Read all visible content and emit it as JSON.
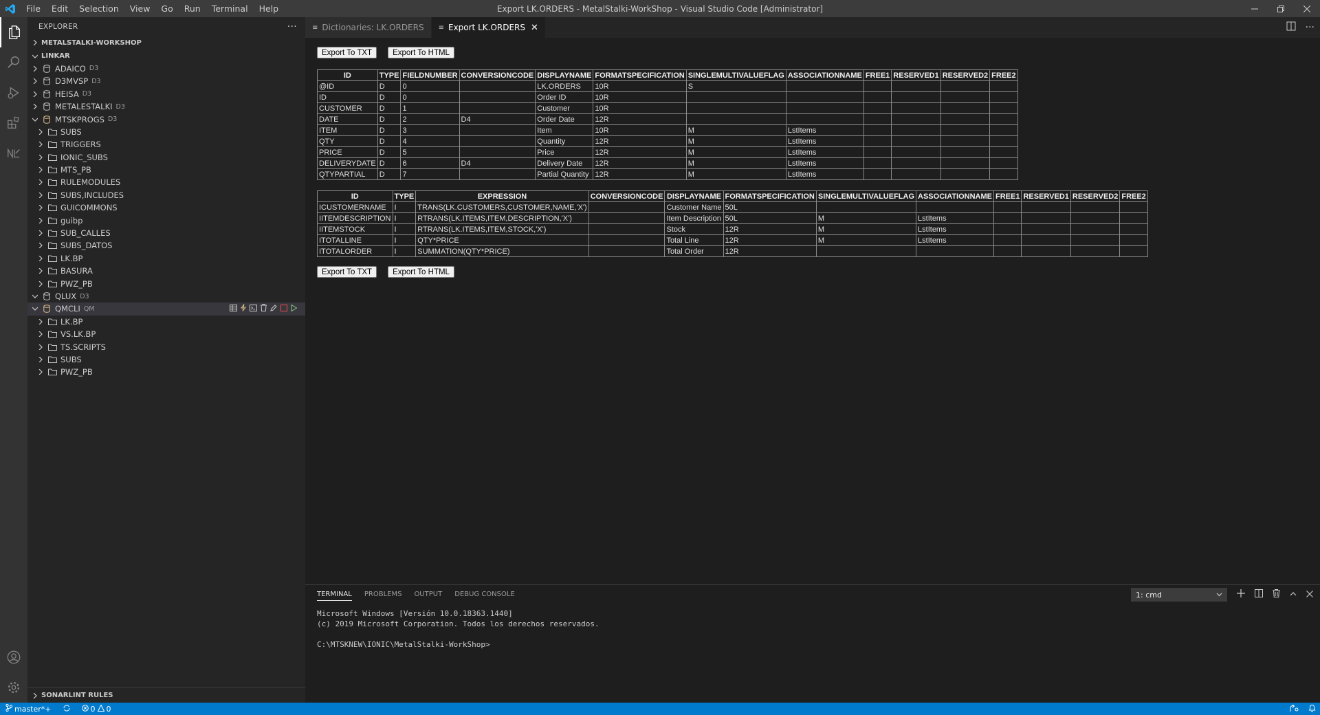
{
  "window": {
    "title": "Export LK.ORDERS - MetalStalki-WorkShop - Visual Studio Code [Administrator]"
  },
  "menu": [
    "File",
    "Edit",
    "Selection",
    "View",
    "Go",
    "Run",
    "Terminal",
    "Help"
  ],
  "sidebar": {
    "title": "EXPLORER",
    "more": "···",
    "sections": {
      "workspace": "METALSTALKI-WORKSHOP",
      "linkar": "LINKAR",
      "sonarlint": "SONARLINT RULES"
    },
    "tree": [
      {
        "label": "ADAICO",
        "tag": "D3",
        "level": 1,
        "kind": "db",
        "expanded": false
      },
      {
        "label": "D3MVSP",
        "tag": "D3",
        "level": 1,
        "kind": "db",
        "expanded": false
      },
      {
        "label": "HEISA",
        "tag": "D3",
        "level": 1,
        "kind": "db",
        "expanded": false
      },
      {
        "label": "METALESTALKI",
        "tag": "D3",
        "level": 1,
        "kind": "db",
        "expanded": false
      },
      {
        "label": "MTSKPROGS",
        "tag": "D3",
        "level": 1,
        "kind": "db-open",
        "expanded": true
      },
      {
        "label": "SUBS",
        "tag": "",
        "level": 2,
        "kind": "folder",
        "expanded": false
      },
      {
        "label": "TRIGGERS",
        "tag": "",
        "level": 2,
        "kind": "folder",
        "expanded": false
      },
      {
        "label": "IONIC_SUBS",
        "tag": "",
        "level": 2,
        "kind": "folder",
        "expanded": false
      },
      {
        "label": "MTS_PB",
        "tag": "",
        "level": 2,
        "kind": "folder",
        "expanded": false
      },
      {
        "label": "RULEMODULES",
        "tag": "",
        "level": 2,
        "kind": "folder",
        "expanded": false
      },
      {
        "label": "SUBS,INCLUDES",
        "tag": "",
        "level": 2,
        "kind": "folder",
        "expanded": false
      },
      {
        "label": "GUICOMMONS",
        "tag": "",
        "level": 2,
        "kind": "folder",
        "expanded": false
      },
      {
        "label": "guibp",
        "tag": "",
        "level": 2,
        "kind": "folder",
        "expanded": false
      },
      {
        "label": "SUB_CALLES",
        "tag": "",
        "level": 2,
        "kind": "folder",
        "expanded": false
      },
      {
        "label": "SUBS_DATOS",
        "tag": "",
        "level": 2,
        "kind": "folder",
        "expanded": false
      },
      {
        "label": "LK.BP",
        "tag": "",
        "level": 2,
        "kind": "folder",
        "expanded": false
      },
      {
        "label": "BASURA",
        "tag": "",
        "level": 2,
        "kind": "folder",
        "expanded": false
      },
      {
        "label": "PWZ_PB",
        "tag": "",
        "level": 2,
        "kind": "folder",
        "expanded": false
      },
      {
        "label": "QLUX",
        "tag": "D3",
        "level": 1,
        "kind": "db",
        "expanded": true
      },
      {
        "label": "QMCLI",
        "tag": "QM",
        "level": 1,
        "kind": "db-open",
        "expanded": true,
        "selected": true
      },
      {
        "label": "LK.BP",
        "tag": "",
        "level": 2,
        "kind": "folder",
        "expanded": false
      },
      {
        "label": "VS.LK.BP",
        "tag": "",
        "level": 2,
        "kind": "folder",
        "expanded": false
      },
      {
        "label": "TS.SCRIPTS",
        "tag": "",
        "level": 2,
        "kind": "folder",
        "expanded": false
      },
      {
        "label": "SUBS",
        "tag": "",
        "level": 2,
        "kind": "folder",
        "expanded": false
      },
      {
        "label": "PWZ_PB",
        "tag": "",
        "level": 2,
        "kind": "folder",
        "expanded": false
      }
    ]
  },
  "tabs": [
    {
      "label": "Dictionaries: LK.ORDERS",
      "active": false
    },
    {
      "label": "Export LK.ORDERS",
      "active": true
    }
  ],
  "editor": {
    "export_txt": "Export To TXT",
    "export_html": "Export To HTML",
    "table1": {
      "headers": [
        "ID",
        "TYPE",
        "FIELDNUMBER",
        "CONVERSIONCODE",
        "DISPLAYNAME",
        "FORMATSPECIFICATION",
        "SINGLEMULTIVALUEFLAG",
        "ASSOCIATIONNAME",
        "FREE1",
        "RESERVED1",
        "RESERVED2",
        "FREE2"
      ],
      "rows": [
        [
          "@ID",
          "D",
          "0",
          "",
          "LK.ORDERS",
          "10R",
          "S",
          "",
          "",
          "",
          "",
          ""
        ],
        [
          "ID",
          "D",
          "0",
          "",
          "Order ID",
          "10R",
          "",
          "",
          "",
          "",
          "",
          ""
        ],
        [
          "CUSTOMER",
          "D",
          "1",
          "",
          "Customer",
          "10R",
          "",
          "",
          "",
          "",
          "",
          ""
        ],
        [
          "DATE",
          "D",
          "2",
          "D4",
          "Order Date",
          "12R",
          "",
          "",
          "",
          "",
          "",
          ""
        ],
        [
          "ITEM",
          "D",
          "3",
          "",
          "Item",
          "10R",
          "M",
          "LstItems",
          "",
          "",
          "",
          ""
        ],
        [
          "QTY",
          "D",
          "4",
          "",
          "Quantity",
          "12R",
          "M",
          "LstItems",
          "",
          "",
          "",
          ""
        ],
        [
          "PRICE",
          "D",
          "5",
          "",
          "Price",
          "12R",
          "M",
          "LstItems",
          "",
          "",
          "",
          ""
        ],
        [
          "DELIVERYDATE",
          "D",
          "6",
          "D4",
          "Delivery Date",
          "12R",
          "M",
          "LstItems",
          "",
          "",
          "",
          ""
        ],
        [
          "QTYPARTIAL",
          "D",
          "7",
          "",
          "Partial Quantity",
          "12R",
          "M",
          "LstItems",
          "",
          "",
          "",
          ""
        ]
      ]
    },
    "table2": {
      "headers": [
        "ID",
        "TYPE",
        "EXPRESSION",
        "CONVERSIONCODE",
        "DISPLAYNAME",
        "FORMATSPECIFICATION",
        "SINGLEMULTIVALUEFLAG",
        "ASSOCIATIONNAME",
        "FREE1",
        "RESERVED1",
        "RESERVED2",
        "FREE2"
      ],
      "rows": [
        [
          "ICUSTOMERNAME",
          "I",
          "TRANS(LK.CUSTOMERS,CUSTOMER,NAME,'X')",
          "",
          "Customer Name",
          "50L",
          "",
          "",
          "",
          "",
          "",
          ""
        ],
        [
          "IITEMDESCRIPTION",
          "I",
          "RTRANS(LK.ITEMS,ITEM,DESCRIPTION,'X')",
          "",
          "Item Description",
          "50L",
          "M",
          "LstItems",
          "",
          "",
          "",
          ""
        ],
        [
          "IITEMSTOCK",
          "I",
          "RTRANS(LK.ITEMS,ITEM,STOCK,'X')",
          "",
          "Stock",
          "12R",
          "M",
          "LstItems",
          "",
          "",
          "",
          ""
        ],
        [
          "ITOTALLINE",
          "I",
          "QTY*PRICE",
          "",
          "Total Line",
          "12R",
          "M",
          "LstItems",
          "",
          "",
          "",
          ""
        ],
        [
          "ITOTALORDER",
          "I",
          "SUMMATION(QTY*PRICE)",
          "",
          "Total Order",
          "12R",
          "",
          "",
          "",
          "",
          "",
          ""
        ]
      ]
    }
  },
  "panel": {
    "tabs": [
      "TERMINAL",
      "PROBLEMS",
      "OUTPUT",
      "DEBUG CONSOLE"
    ],
    "terminal_select": "1: cmd",
    "terminal_lines": [
      "Microsoft Windows [Versión 10.0.18363.1440]",
      "(c) 2019 Microsoft Corporation. Todos los derechos reservados.",
      "",
      "C:\\MTSKNEW\\IONIC\\MetalStalki-WorkShop>"
    ]
  },
  "status": {
    "branch": "master*+",
    "errors": "0",
    "warnings": "0"
  },
  "colors": {
    "accent": "#007acc",
    "folder": "#c09553",
    "db_open": "#e2c08d"
  }
}
